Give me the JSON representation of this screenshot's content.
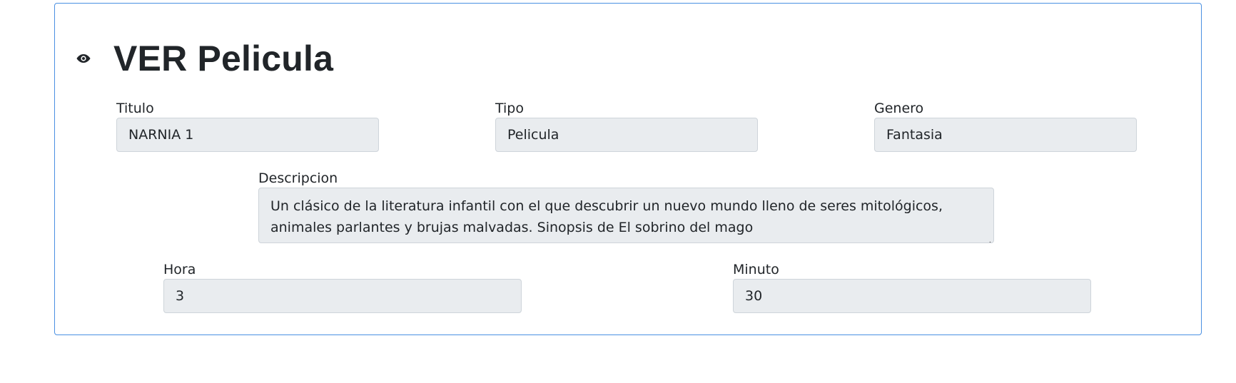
{
  "page": {
    "title": "VER Pelicula",
    "title_icon": "eye-icon"
  },
  "fields": {
    "titulo": {
      "label": "Titulo",
      "value": "NARNIA 1"
    },
    "tipo": {
      "label": "Tipo",
      "value": "Pelicula"
    },
    "genero": {
      "label": "Genero",
      "value": "Fantasia"
    },
    "descripcion": {
      "label": "Descripcion",
      "value": "Un clásico de la literatura infantil con el que descubrir un nuevo mundo lleno de seres mitológicos, animales parlantes y brujas malvadas. Sinopsis de El sobrino del mago"
    },
    "hora": {
      "label": "Hora",
      "value": "3"
    },
    "minuto": {
      "label": "Minuto",
      "value": "30"
    }
  },
  "colors": {
    "card_border": "#4a90e2",
    "input_background": "#e9ecef",
    "input_border": "#ced4da",
    "text": "#212529"
  }
}
